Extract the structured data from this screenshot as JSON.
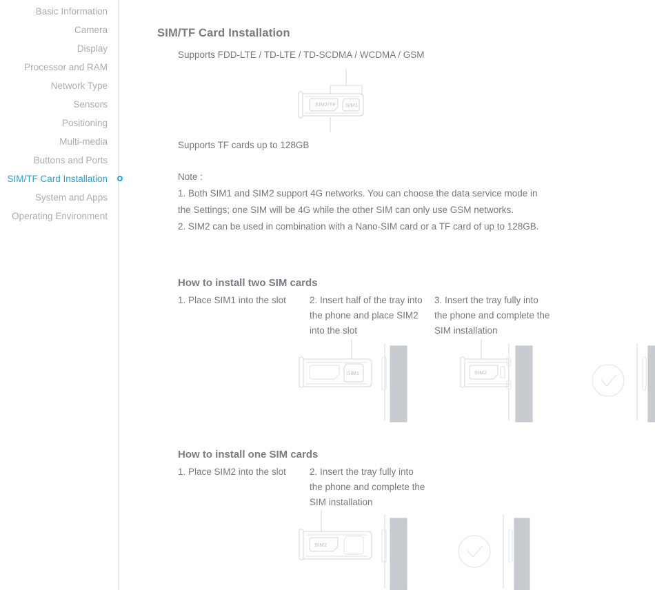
{
  "sidebar": {
    "items": [
      {
        "label": "Basic Information",
        "active": false
      },
      {
        "label": "Camera",
        "active": false
      },
      {
        "label": "Display",
        "active": false
      },
      {
        "label": "Processor and RAM",
        "active": false
      },
      {
        "label": "Network Type",
        "active": false
      },
      {
        "label": "Sensors",
        "active": false
      },
      {
        "label": "Positioning",
        "active": false
      },
      {
        "label": "Multi-media",
        "active": false
      },
      {
        "label": "Buttons and Ports",
        "active": false
      },
      {
        "label": "SIM/TF Card Installation",
        "active": true
      },
      {
        "label": "System and Apps",
        "active": false
      },
      {
        "label": "Operating Environment",
        "active": false
      }
    ],
    "active_indicator_color": "#2a9fd6"
  },
  "content": {
    "title": "SIM/TF Card Installation",
    "lead": "Supports FDD-LTE / TD-LTE / TD-SCDMA / WCDMA / GSM",
    "tf_support": "Supports TF cards up to 128GB",
    "note": {
      "heading": "Note :",
      "lines": [
        "1. Both SIM1 and SIM2 support 4G networks. You can choose the data service mode in",
        "the Settings; one SIM will be 4G while the other SIM can only use GSM networks.",
        "2. SIM2 can be used in combination with a Nano-SIM card or a TF card of up to 128GB."
      ]
    },
    "tray_overview": {
      "slot_left_label": "SIM2/TF",
      "slot_right_label": "SIM1"
    },
    "sections": [
      {
        "heading": "How to install two SIM cards",
        "steps": [
          {
            "caption": "1. Place SIM1 into the slot",
            "card_label": "SIM1"
          },
          {
            "caption": "2. Insert half of the tray into the phone and place SIM2 into the slot",
            "card_label": "SIM2"
          },
          {
            "caption": "3. Insert the tray fully into the phone and complete the SIM installation",
            "card_label": ""
          }
        ]
      },
      {
        "heading": "How to install one SIM cards",
        "steps": [
          {
            "caption": "1. Place SIM2 into the slot",
            "card_label": "SIM2"
          },
          {
            "caption": "2. Insert the tray fully into the phone and complete the SIM installation",
            "card_label": ""
          }
        ]
      }
    ]
  },
  "colors": {
    "accent": "#2a9fd6",
    "body_text": "#75797d",
    "muted_text": "#a7adb2",
    "line": "#d3d7da",
    "phone_gray": "#c3c7cb"
  }
}
